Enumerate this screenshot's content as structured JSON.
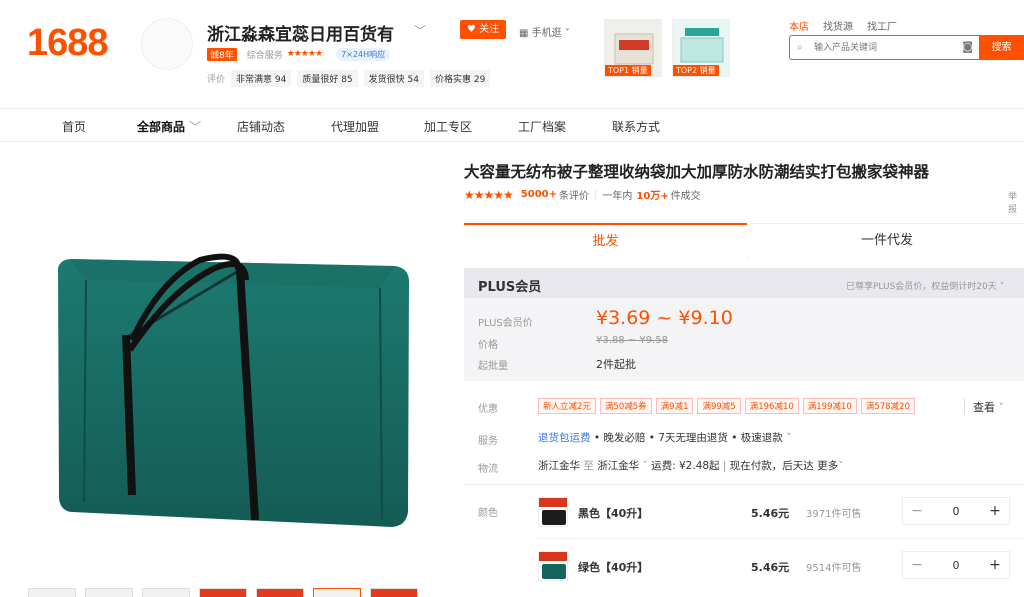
{
  "header": {
    "logo": "1688",
    "shop_name": "浙江淼森宜蕊日用百货有",
    "follow_label": "关注",
    "mobile_shop": "手机逛",
    "years_badge": "诚8年",
    "rating_label": "综合服务",
    "rating_stars": "★★★★★",
    "response_badge": "7×24H响应",
    "eval_label": "评价",
    "scores": [
      "非常满意 94",
      "质量很好 85",
      "发货很快 54",
      "价格实惠 29"
    ],
    "top_products": [
      {
        "badge": "TOP1 销量"
      },
      {
        "badge": "TOP2 销量"
      }
    ],
    "search_tabs": [
      "本店",
      "找货源",
      "找工厂"
    ],
    "search_placeholder": "输入产品关键词",
    "search_button": "搜索"
  },
  "nav": {
    "items": [
      "首页",
      "全部商品",
      "店铺动态",
      "代理加盟",
      "加工专区",
      "工厂档案",
      "联系方式"
    ]
  },
  "product": {
    "title": "大容量无纺布被子整理收纳袋加大加厚防水防潮结实打包搬家袋神器",
    "title_right": "举报",
    "stars": "★★★★★",
    "review_count": "5000+",
    "review_label": "条评价",
    "deal_prefix": "一年内",
    "deal_count": "10万+",
    "deal_suffix": "件成交",
    "tab_wholesale": "批发",
    "tab_dropship": "一件代发"
  },
  "plus": {
    "title": "PLUS会员",
    "note": "已尊享PLUS会员价，权益倒计时20天",
    "member_price_label": "PLUS会员价",
    "member_price": "¥3.69 ~ ¥9.10",
    "price_label": "价格",
    "orig_price": "¥3.88 ~ ¥9.58",
    "moq_label": "起批量",
    "moq": "2件起批"
  },
  "offers": {
    "label": "优惠",
    "promos": [
      "新人立减2元",
      "满50减5券",
      "满9减1",
      "满99减5",
      "满196减10",
      "满199减10",
      "满578减20"
    ],
    "more": "查看"
  },
  "service": {
    "label": "服务",
    "highlight": "退货包运费",
    "rest": " • 晚发必赔 • 7天无理由退货 • 极速退款"
  },
  "shipping": {
    "label": "物流",
    "from": "浙江金华",
    "to_word": "至",
    "to": "浙江金华",
    "fee": "运费: ¥2.48起",
    "eta": "现在付款，后天达",
    "more": "更多"
  },
  "colors": {
    "label": "颜色",
    "variants": [
      {
        "name": "黑色【40升】",
        "price": "5.46元",
        "stock": "3971件可售",
        "qty": "0",
        "swatch": "#1c1c1c"
      },
      {
        "name": "绿色【40升】",
        "price": "5.46元",
        "stock": "9514件可售",
        "qty": "0",
        "swatch": "#17645e"
      }
    ]
  },
  "accent": "#ff5000"
}
